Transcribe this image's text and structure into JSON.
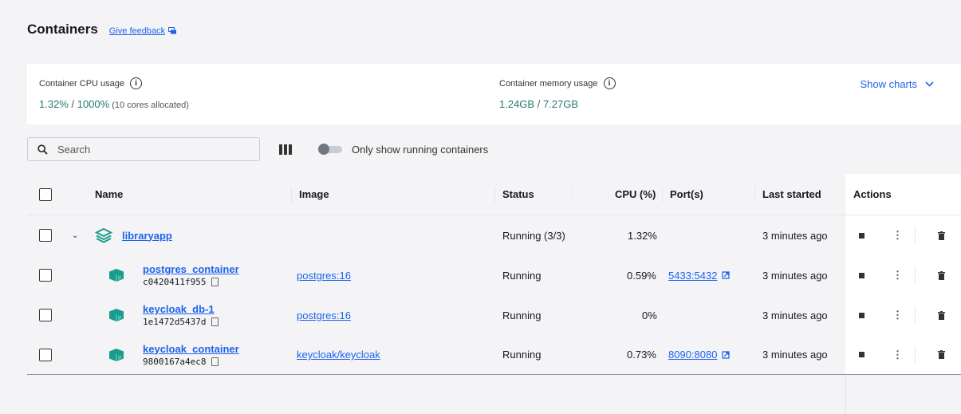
{
  "header": {
    "title": "Containers",
    "feedback_label": "Give feedback"
  },
  "stats": {
    "cpu": {
      "label": "Container CPU usage",
      "value": "1.32%",
      "separator": " / ",
      "total": "1000%",
      "note": " (10 cores allocated)"
    },
    "memory": {
      "label": "Container memory usage",
      "value": "1.24GB",
      "separator": " / ",
      "total": "7.27GB"
    },
    "show_charts_label": "Show charts"
  },
  "toolbar": {
    "search_placeholder": "Search",
    "toggle_label": "Only show running containers"
  },
  "table": {
    "headers": {
      "name": "Name",
      "image": "Image",
      "status": "Status",
      "cpu": "CPU (%)",
      "ports": "Port(s)",
      "last_started": "Last started",
      "actions": "Actions"
    },
    "group": {
      "name": "libraryapp",
      "status": "Running (3/3)",
      "cpu": "1.32%",
      "last_started": "3 minutes ago"
    },
    "rows": [
      {
        "name": "postgres_container",
        "id": "c0420411f955",
        "image": "postgres:16",
        "status": "Running",
        "cpu": "0.59%",
        "port": "5433:5432",
        "last_started": "3 minutes ago"
      },
      {
        "name": "keycloak_db-1",
        "id": "1e1472d5437d",
        "image": "postgres:16",
        "status": "Running",
        "cpu": "0%",
        "port": "",
        "last_started": "3 minutes ago"
      },
      {
        "name": "keycloak_container",
        "id": "9800167a4ec8",
        "image": "keycloak/keycloak",
        "status": "Running",
        "cpu": "0.73%",
        "port": "8090:8080",
        "last_started": "3 minutes ago"
      }
    ]
  },
  "colors": {
    "link": "#1d63ed",
    "stat_value": "#217a6f",
    "container_icon": "#1a9c8c"
  }
}
